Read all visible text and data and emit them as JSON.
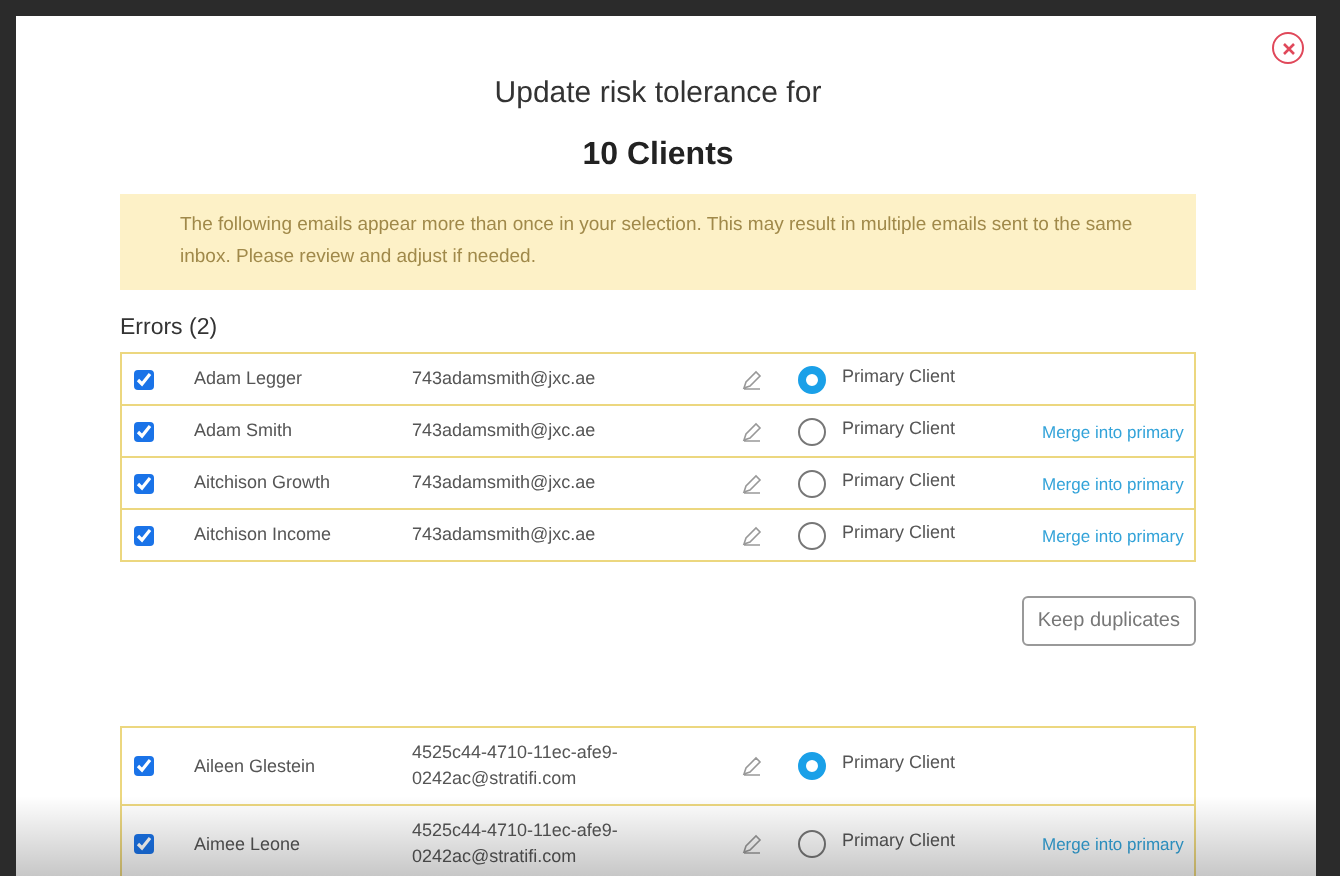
{
  "dialog": {
    "title": "Update risk tolerance for",
    "subtitle": "10 Clients",
    "warning": "The following emails appear more than once in your selection. This may result in multiple emails sent to the same inbox. Please review and adjust if needed."
  },
  "errors_heading": "Errors (2)",
  "groups": [
    {
      "rows": [
        {
          "checked": true,
          "name": "Adam Legger",
          "email": "743adamsmith@jxc.ae",
          "primary_label": "Primary Client",
          "selected": true
        },
        {
          "checked": true,
          "name": "Adam Smith",
          "email": "743adamsmith@jxc.ae",
          "primary_label": "Primary Client",
          "selected": false,
          "merge": "Merge into primary"
        },
        {
          "checked": true,
          "name": "Aitchison Growth",
          "email": "743adamsmith@jxc.ae",
          "primary_label": "Primary Client",
          "selected": false,
          "merge": "Merge into primary"
        },
        {
          "checked": true,
          "name": "Aitchison Income",
          "email": "743adamsmith@jxc.ae",
          "primary_label": "Primary Client",
          "selected": false,
          "merge": "Merge into primary"
        }
      ],
      "button": "Keep duplicates"
    },
    {
      "rows": [
        {
          "checked": true,
          "name": "Aileen Glestein",
          "email": "4525c44-4710-11ec-afe9-0242ac@stratifi.com",
          "primary_label": "Primary Client",
          "selected": true
        },
        {
          "checked": true,
          "name": "Aimee Leone",
          "email": "4525c44-4710-11ec-afe9-0242ac@stratifi.com",
          "primary_label": "Primary Client",
          "selected": false,
          "merge": "Merge into primary"
        }
      ]
    }
  ]
}
